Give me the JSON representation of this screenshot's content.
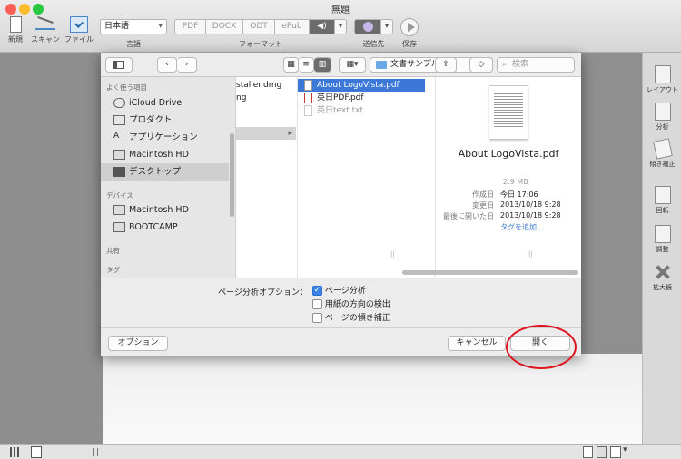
{
  "app": {
    "title": "無題"
  },
  "toolbar": {
    "new_label": "新規",
    "scan_label": "スキャン",
    "file_label": "ファイル",
    "language_value": "日本語",
    "language_label": "言語",
    "formats": [
      "PDF",
      "DOCX",
      "ODT",
      "ePub"
    ],
    "format_label": "フォーマット",
    "send_label": "送信先",
    "save_label": "保存"
  },
  "right_panel": {
    "items": [
      "レイアウト",
      "分析",
      "傾き補正",
      "回転",
      "調整",
      "拡大鏡"
    ]
  },
  "dialog": {
    "location": "文書サンプル",
    "search_placeholder": "検索",
    "sidebar": {
      "favorites_header": "よく使う項目",
      "favorites": [
        "iCloud Drive",
        "プロダクト",
        "アプリケーション",
        "Macintosh HD",
        "デスクトップ"
      ],
      "devices_header": "デバイス",
      "devices": [
        "Macintosh HD",
        "BOOTCAMP"
      ],
      "shared_header": "共有",
      "tags_header": "タグ"
    },
    "col1": [
      "staller.dmg",
      "ng",
      ""
    ],
    "files": [
      "About LogoVista.pdf",
      "英日PDF.pdf",
      "英日text.txt"
    ],
    "preview": {
      "name": "About LogoVista.pdf",
      "size": "2.9 MB",
      "rows": [
        {
          "label": "作成日",
          "value": "今日 17:06"
        },
        {
          "label": "変更日",
          "value": "2013/10/18 9:28"
        },
        {
          "label": "最後に開いた日",
          "value": "2013/10/18 9:28"
        }
      ],
      "tags_link": "タグを追加..."
    },
    "options": {
      "label": "ページ分析オプション：",
      "checkboxes": [
        {
          "label": "ページ分析",
          "checked": true
        },
        {
          "label": "用紙の方向の検出",
          "checked": false
        },
        {
          "label": "ページの傾き補正",
          "checked": false
        }
      ]
    },
    "options_button": "オプション",
    "cancel_button": "キャンセル",
    "open_button": "開く"
  },
  "colors": {
    "accent": "#3b78d7",
    "annotation": "#e0141e"
  }
}
